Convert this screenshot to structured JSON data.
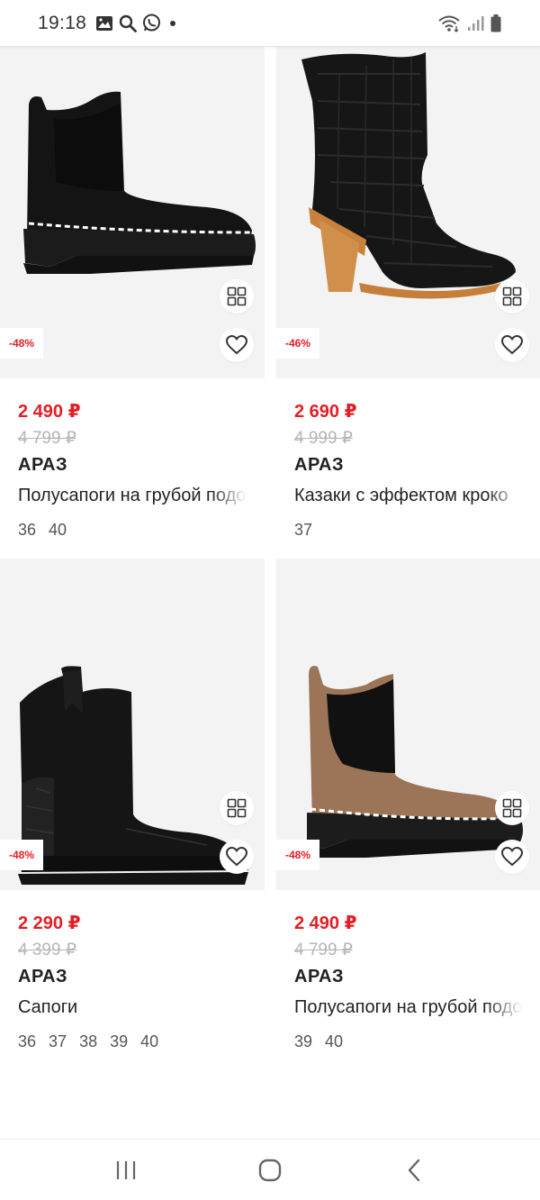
{
  "status_bar": {
    "time": "19:18",
    "left_icons": [
      "image-icon",
      "search-icon",
      "whatsapp-icon",
      "dot-icon"
    ],
    "right_icons": [
      "wifi-icon",
      "signal-icon",
      "battery-icon"
    ]
  },
  "colors": {
    "accent": "#e31e24",
    "old_price": "#b5b5b5",
    "photo_bg": "#f2f2f2"
  },
  "products": [
    {
      "image": "black-suede-chelsea-boot",
      "discount": "-48%",
      "price": "2 490 ₽",
      "old_price": "4 799 ₽",
      "brand": "АРАЗ",
      "name": "Полусапоги на грубой подошве",
      "sizes": [
        "36",
        "40"
      ]
    },
    {
      "image": "black-croc-cowboy-boot",
      "discount": "-46%",
      "price": "2 690 ₽",
      "old_price": "4 999 ₽",
      "brand": "АРАЗ",
      "name": "Казаки с эффектом кроко",
      "sizes": [
        "37"
      ]
    },
    {
      "image": "black-leather-boot",
      "discount": "-48%",
      "price": "2 290 ₽",
      "old_price": "4 399 ₽",
      "brand": "АРАЗ",
      "name": "Сапоги",
      "sizes": [
        "36",
        "37",
        "38",
        "39",
        "40"
      ]
    },
    {
      "image": "brown-suede-chelsea-boot",
      "discount": "-48%",
      "price": "2 490 ₽",
      "old_price": "4 799 ₽",
      "brand": "АРАЗ",
      "name": "Полусапоги на грубой подошве",
      "sizes": [
        "39",
        "40"
      ]
    }
  ],
  "nav_bar": {
    "buttons": [
      "recent-apps-icon",
      "home-icon",
      "back-icon"
    ]
  }
}
